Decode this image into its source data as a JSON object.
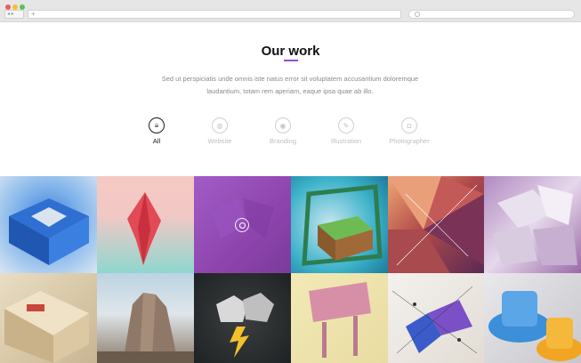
{
  "browser": {
    "nav_symbols": "◂ ▸",
    "new_tab_symbol": "+"
  },
  "header": {
    "title": "Our work",
    "description": "Sed ut perspiciatis unde omnis iste natus error sit voluptatem accusantium doloremque laudantium, totam rem aperiam, eaque ipsa quae ab illo."
  },
  "filters": [
    {
      "label": "All",
      "icon": "menu-icon",
      "glyph": "≡",
      "active": true
    },
    {
      "label": "Website",
      "icon": "globe-icon",
      "glyph": "◍",
      "active": false
    },
    {
      "label": "Branding",
      "icon": "branding-icon",
      "glyph": "◉",
      "active": false
    },
    {
      "label": "Illustration",
      "icon": "pencil-icon",
      "glyph": "✎",
      "active": false
    },
    {
      "label": "Photographer",
      "icon": "camera-icon",
      "glyph": "◘",
      "active": false
    }
  ],
  "colors": {
    "accent": "#9b4dca",
    "active_filter": "#1a1a1a",
    "inactive_filter": "#c0c0c0"
  },
  "gallery": {
    "hovered_tile_icon": "search-icon"
  }
}
